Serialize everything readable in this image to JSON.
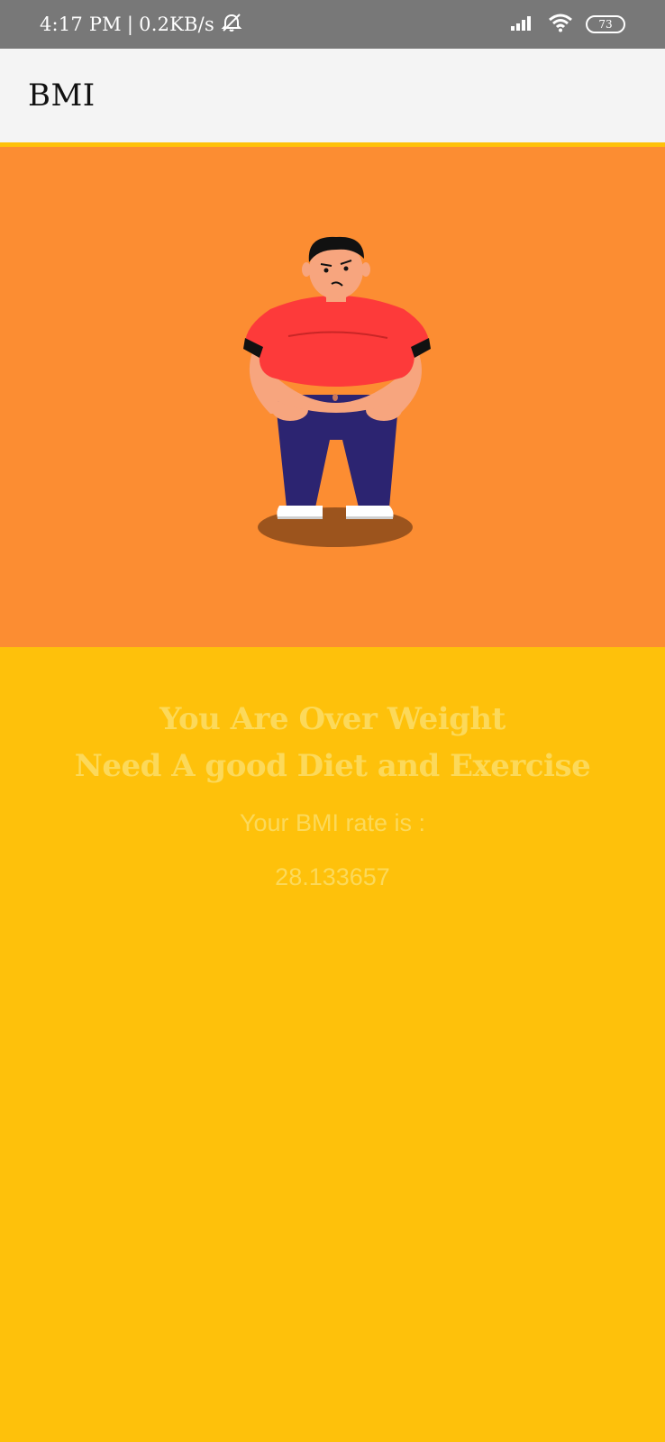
{
  "status_bar": {
    "time": "4:17 PM",
    "separator": "|",
    "network_speed": "0.2KB/s",
    "icons": [
      "alarm-off-icon",
      "signal-icon",
      "wifi-icon",
      "battery-icon"
    ],
    "battery_level": "73"
  },
  "app_bar": {
    "title": "BMI"
  },
  "hero": {
    "image": "overweight-person-illustration",
    "background_color": "#FC8D32"
  },
  "result": {
    "headline_line1": "You Are Over Weight",
    "headline_line2": "Need A good Diet and Exercise",
    "bmi_label": "Your BMI rate is :",
    "bmi_value": "28.133657",
    "background_color": "#FEC10B",
    "text_color": "#FCD95A"
  }
}
